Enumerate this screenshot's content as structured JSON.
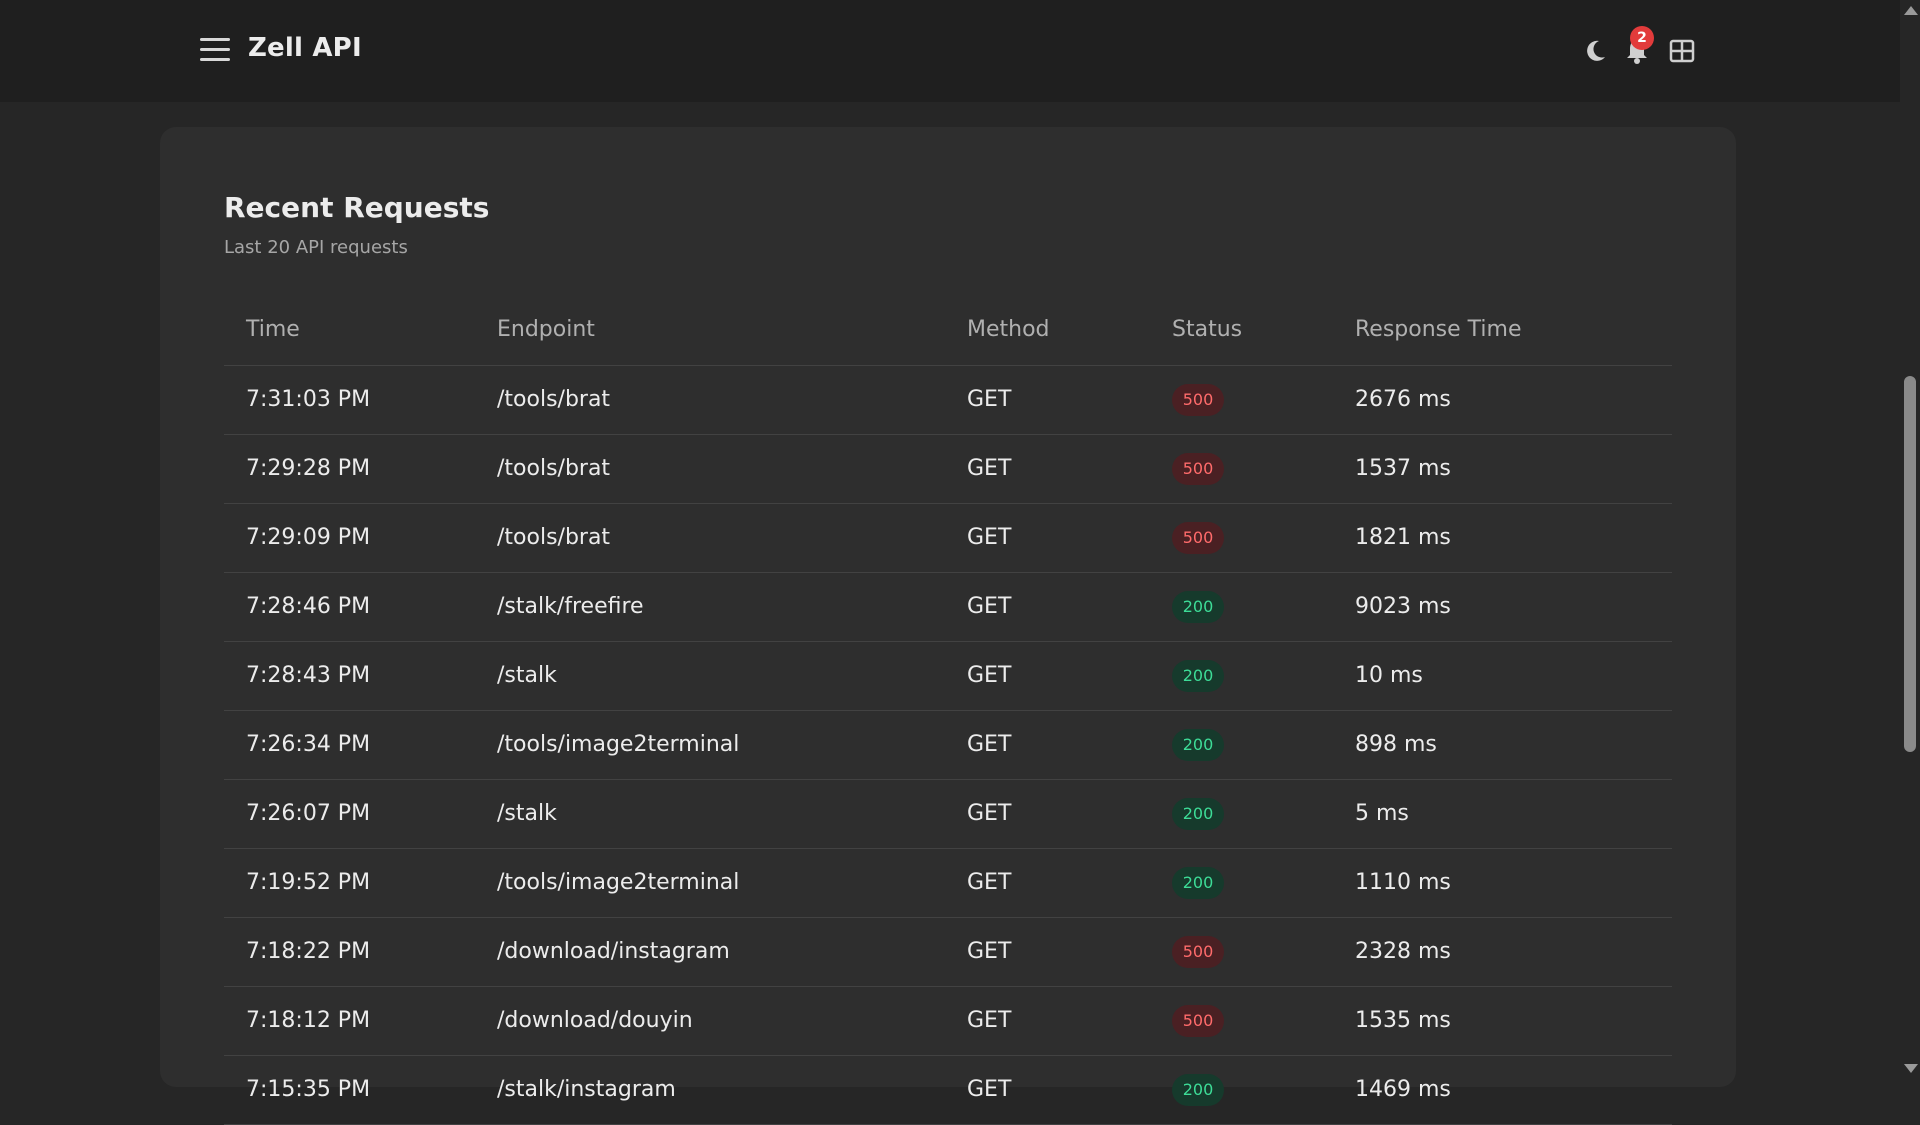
{
  "header": {
    "title": "Zell API",
    "notification_count": "2",
    "icons": [
      "menu-icon",
      "moon-icon",
      "bell-icon",
      "grid-icon"
    ]
  },
  "card": {
    "title": "Recent Requests",
    "subtitle": "Last 20 API requests"
  },
  "table": {
    "columns": [
      "Time",
      "Endpoint",
      "Method",
      "Status",
      "Response Time"
    ],
    "rows": [
      {
        "time": "7:31:03 PM",
        "endpoint": "/tools/brat",
        "method": "GET",
        "status": "500",
        "response_time": "2676 ms"
      },
      {
        "time": "7:29:28 PM",
        "endpoint": "/tools/brat",
        "method": "GET",
        "status": "500",
        "response_time": "1537 ms"
      },
      {
        "time": "7:29:09 PM",
        "endpoint": "/tools/brat",
        "method": "GET",
        "status": "500",
        "response_time": "1821 ms"
      },
      {
        "time": "7:28:46 PM",
        "endpoint": "/stalk/freefire",
        "method": "GET",
        "status": "200",
        "response_time": "9023 ms"
      },
      {
        "time": "7:28:43 PM",
        "endpoint": "/stalk",
        "method": "GET",
        "status": "200",
        "response_time": "10 ms"
      },
      {
        "time": "7:26:34 PM",
        "endpoint": "/tools/image2terminal",
        "method": "GET",
        "status": "200",
        "response_time": "898 ms"
      },
      {
        "time": "7:26:07 PM",
        "endpoint": "/stalk",
        "method": "GET",
        "status": "200",
        "response_time": "5 ms"
      },
      {
        "time": "7:19:52 PM",
        "endpoint": "/tools/image2terminal",
        "method": "GET",
        "status": "200",
        "response_time": "1110 ms"
      },
      {
        "time": "7:18:22 PM",
        "endpoint": "/download/instagram",
        "method": "GET",
        "status": "500",
        "response_time": "2328 ms"
      },
      {
        "time": "7:18:12 PM",
        "endpoint": "/download/douyin",
        "method": "GET",
        "status": "500",
        "response_time": "1535 ms"
      },
      {
        "time": "7:15:35 PM",
        "endpoint": "/stalk/instagram",
        "method": "GET",
        "status": "200",
        "response_time": "1469 ms"
      }
    ]
  },
  "colors": {
    "status_error": "#ff6b6b",
    "status_ok": "#3ddc97",
    "badge": "#e23b3b"
  }
}
